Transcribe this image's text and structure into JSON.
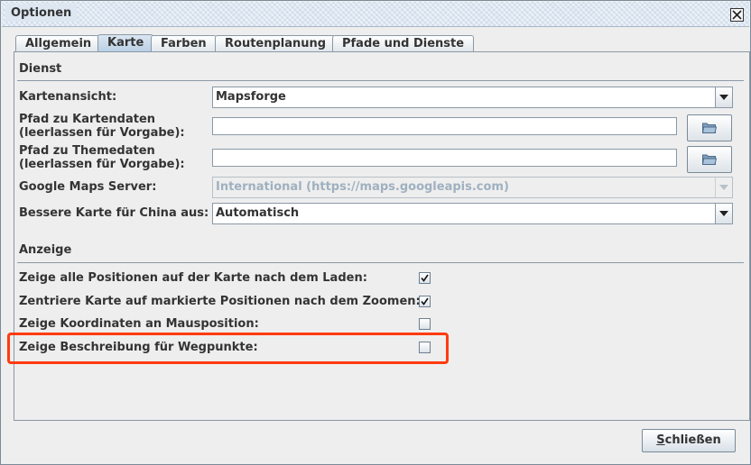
{
  "window": {
    "title": "Optionen"
  },
  "tabs": [
    {
      "label": "Allgemein",
      "active": false
    },
    {
      "label": "Karte",
      "active": true
    },
    {
      "label": "Farben",
      "active": false
    },
    {
      "label": "Routenplanung",
      "active": false
    },
    {
      "label": "Pfade und Dienste",
      "active": false
    }
  ],
  "dienst": {
    "title": "Dienst",
    "kartenansicht": {
      "label": "Kartenansicht:",
      "value": "Mapsforge"
    },
    "kartendaten": {
      "label_line1": "Pfad zu Kartendaten",
      "label_line2": "(leerlassen für Vorgabe):",
      "value": ""
    },
    "themedaten": {
      "label_line1": "Pfad zu Themedaten",
      "label_line2": "(leerlassen für Vorgabe):",
      "value": ""
    },
    "google_server": {
      "label": "Google Maps Server:",
      "value": "International (https://maps.googleapis.com)",
      "enabled": false
    },
    "china": {
      "label": "Bessere Karte für China aus:",
      "value": "Automatisch"
    }
  },
  "anzeige": {
    "title": "Anzeige",
    "options": [
      {
        "label": "Zeige alle Positionen auf der Karte nach dem Laden:",
        "checked": true
      },
      {
        "label": "Zentriere Karte auf markierte Positionen nach dem Zoomen:",
        "checked": true
      },
      {
        "label": "Zeige Koordinaten an Mausposition:",
        "checked": false
      },
      {
        "label": "Zeige Beschreibung für Wegpunkte:",
        "checked": false
      }
    ]
  },
  "buttons": {
    "close_mnemonic": "S",
    "close_rest": "chließen"
  },
  "colors": {
    "highlight": "#ff3b0f",
    "titlebar": "#dde7f2",
    "panel_border": "#8a99a6"
  },
  "icons": {
    "close": "close-icon",
    "dropdown": "chevron-down-icon",
    "browse": "folder-icon",
    "check": "check-icon"
  }
}
